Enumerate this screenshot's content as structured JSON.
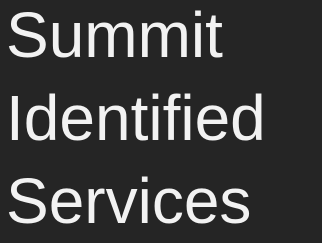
{
  "colors": {
    "background": "#252525",
    "text": "#f2f2f2"
  },
  "title": {
    "lines": [
      "Summit",
      "Identified",
      "Services"
    ]
  }
}
